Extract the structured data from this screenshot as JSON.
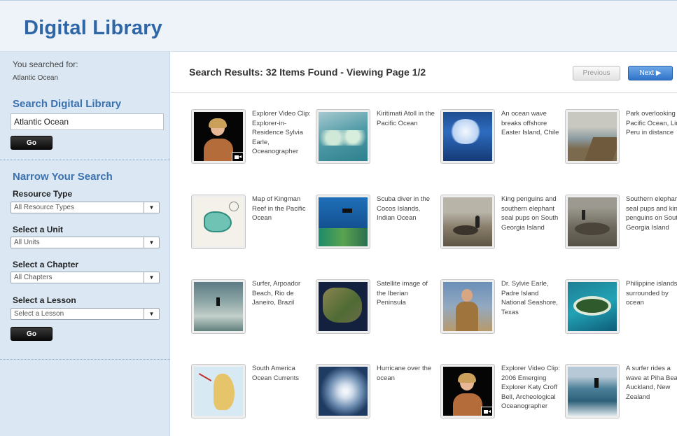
{
  "header": {
    "title": "Digital Library"
  },
  "sidebar": {
    "searched_label": "You searched for:",
    "searched_term": "Atlantic Ocean",
    "search_title": "Search Digital Library",
    "search_value": "Atlantic Ocean",
    "go_label": "Go",
    "narrow_title": "Narrow Your Search",
    "filters": [
      {
        "label": "Resource Type",
        "value": "All Resource Types"
      },
      {
        "label": "Select a Unit",
        "value": "All Units"
      },
      {
        "label": "Select a Chapter",
        "value": "All Chapters"
      },
      {
        "label": "Select a Lesson",
        "value": "Select a Lesson"
      }
    ],
    "go2_label": "Go"
  },
  "results": {
    "title": "Search Results: 32 Items Found - Viewing Page 1/2",
    "prev_label": "Previous",
    "next_label": "Next ▶",
    "items": [
      {
        "caption": "Explorer Video Clip: Explorer-in-Residence Sylvia Earle, Oceanographer",
        "video": true,
        "thumb": "video-portrait"
      },
      {
        "caption": "Kiritimati Atoll in the Pacific Ocean",
        "video": false,
        "thumb": "atoll"
      },
      {
        "caption": "An ocean wave breaks offshore Easter Island, Chile",
        "video": false,
        "thumb": "wave"
      },
      {
        "caption": "Park overlooking Pacific Ocean, Lima, Peru in distance",
        "video": false,
        "thumb": "coast"
      },
      {
        "caption": "Map of Kingman Reef in the Pacific Ocean",
        "video": false,
        "thumb": "map-reef"
      },
      {
        "caption": "Scuba diver in the Cocos Islands, Indian Ocean",
        "video": false,
        "thumb": "scuba"
      },
      {
        "caption": "King penguins and southern elephant seal pups on South Georgia Island",
        "video": false,
        "thumb": "penguins"
      },
      {
        "caption": "Southern elephant seal pups and king penguins on South Georgia Island",
        "video": false,
        "thumb": "seals"
      },
      {
        "caption": "Surfer, Arpoador Beach, Rio de Janeiro, Brazil",
        "video": false,
        "thumb": "surfer"
      },
      {
        "caption": "Satellite image of the Iberian Peninsula",
        "video": false,
        "thumb": "satellite"
      },
      {
        "caption": "Dr. Sylvie Earle, Padre Island National Seashore, Texas",
        "video": false,
        "thumb": "portrait-beach"
      },
      {
        "caption": "Philippine islands surrounded by ocean",
        "video": false,
        "thumb": "island"
      },
      {
        "caption": "South America Ocean Currents",
        "video": false,
        "thumb": "map-currents"
      },
      {
        "caption": "Hurricane over the ocean",
        "video": false,
        "thumb": "hurricane"
      },
      {
        "caption": "Explorer Video Clip: 2006 Emerging Explorer Katy Croff Bell, Archeological Oceanographer",
        "video": true,
        "thumb": "video-portrait"
      },
      {
        "caption": "A surfer rides a wave at Piha Beach, Auckland, New Zealand",
        "video": false,
        "thumb": "surf-wave"
      }
    ]
  },
  "colors": {
    "brand": "#2e66a8",
    "sidebar_bg": "#dbe8f4",
    "next_button": "#2f73c8"
  }
}
